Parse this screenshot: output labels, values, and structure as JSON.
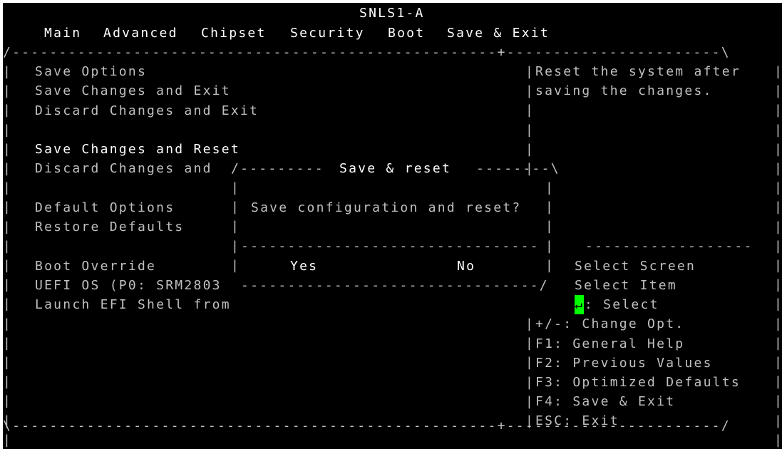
{
  "title": "SNLS1-A",
  "menu": [
    "Main",
    "Advanced",
    "Chipset",
    "Security",
    "Boot",
    "Save & Exit"
  ],
  "main_items": {
    "save_options_header": "Save Options",
    "save_changes_exit": "Save Changes and Exit",
    "discard_changes_exit": "Discard Changes and Exit",
    "save_changes_reset": "Save Changes and Reset",
    "discard_changes_reset": "Discard Changes and",
    "default_options_header": "Default Options",
    "restore_defaults": "Restore Defaults",
    "boot_override_header": "Boot Override",
    "uefi_os": "UEFI OS (P0: SRM2803",
    "launch_efi_shell": "Launch EFI Shell from"
  },
  "help_text": [
    "Reset the system after",
    "saving the changes."
  ],
  "dialog": {
    "title": "Save & reset",
    "message": "Save configuration and reset?",
    "yes": "Yes",
    "no": "No"
  },
  "keys": {
    "select_screen": "Select Screen",
    "select_item": "Select Item",
    "enter_key": "↵",
    "enter_action": ": Select",
    "change_opt": "+/-: Change Opt.",
    "f1": "F1: General Help",
    "f2": "F2: Previous Values",
    "f3": "F3: Optimized Defaults",
    "f4": "F4: Save & Exit",
    "esc": "ESC: Exit"
  },
  "colors": {
    "background": "#000000",
    "text": "#c0c0c0",
    "highlight_text": "#ffffff",
    "key_highlight_bg": "#00ff00"
  }
}
